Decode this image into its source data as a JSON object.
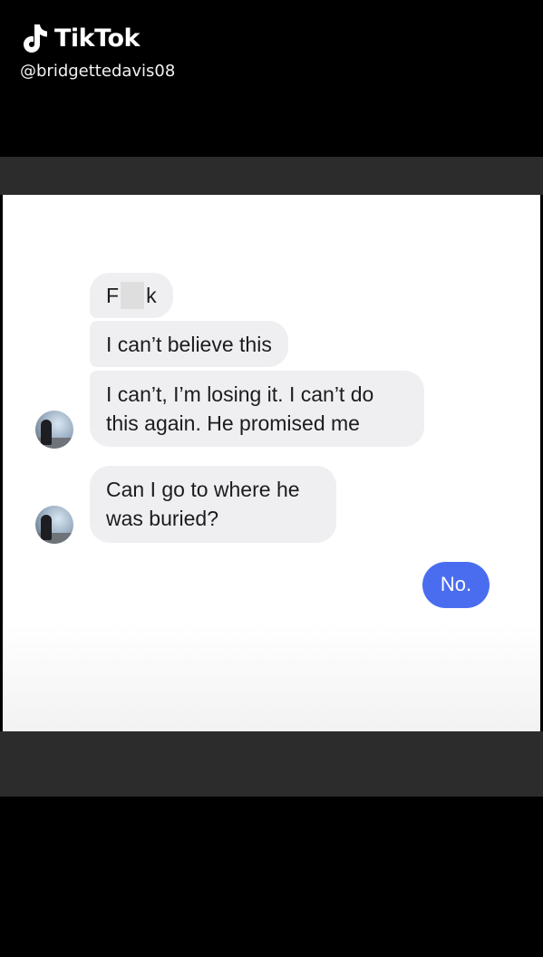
{
  "watermark": {
    "brand": "TikTok",
    "handle": "@bridgettedavis08",
    "logo_icon": "tiktok-note-icon"
  },
  "chat": {
    "messages": [
      {
        "from": "them",
        "parts": [
          "F",
          "k"
        ]
      },
      {
        "from": "them",
        "text": "I can’t believe this"
      },
      {
        "from": "them",
        "text": "I can’t, I’m losing it. I can’t do\nthis again. He promised me"
      },
      {
        "from": "them",
        "text": "Can I go to where he\nwas buried?"
      },
      {
        "from": "me",
        "text": "No."
      }
    ]
  },
  "colors": {
    "received_bubble": "#efeff1",
    "sent_bubble": "#4a6df0",
    "letterbox": "#2c2c2c"
  }
}
